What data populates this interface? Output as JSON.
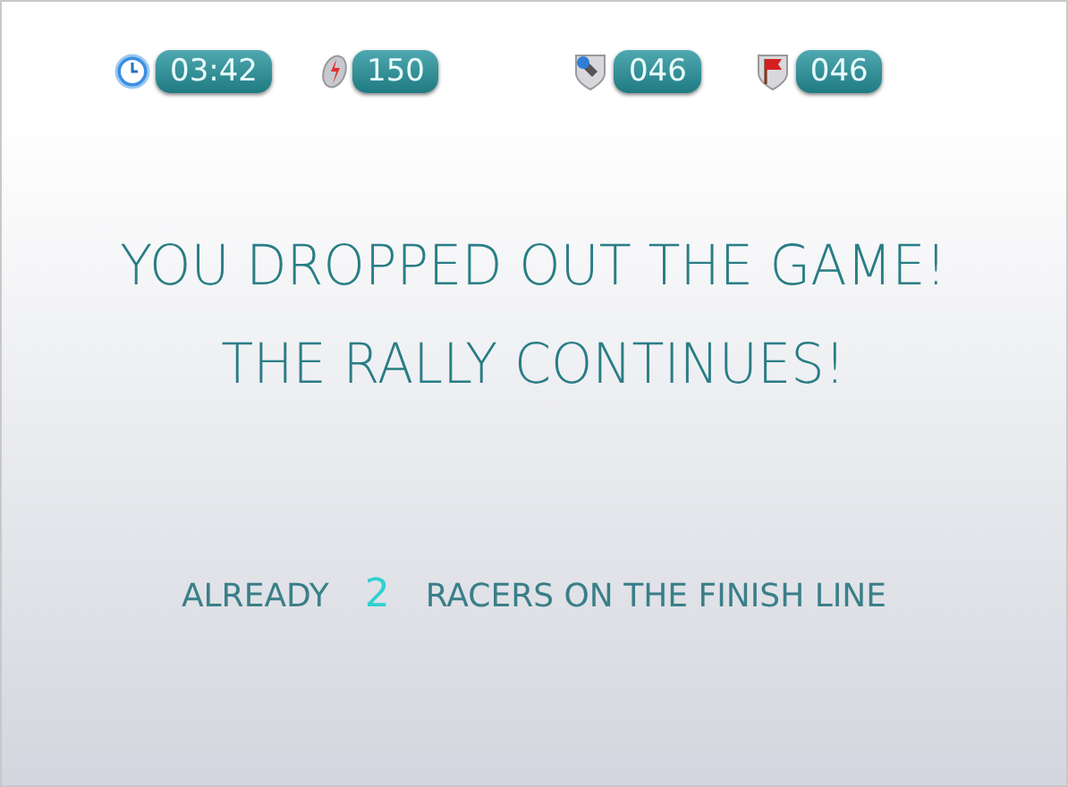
{
  "stats": [
    {
      "kind": "clock",
      "value": "03:42"
    },
    {
      "kind": "bolt",
      "value": "150"
    },
    {
      "kind": "flashlight",
      "value": "046"
    },
    {
      "kind": "flag",
      "value": "046"
    }
  ],
  "message": [
    "YOU DROPPED OUT THE GAME!",
    "THE RALLY CONTINUES!"
  ],
  "finish": {
    "prefix": "ALREADY",
    "count": "2",
    "suffix": "RACERS ON THE FINISH LINE"
  }
}
